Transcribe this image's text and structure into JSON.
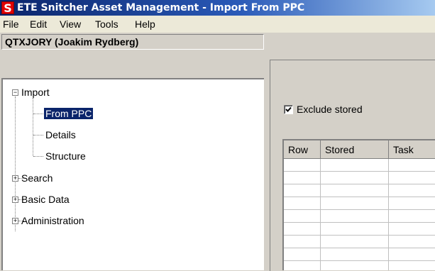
{
  "window": {
    "icon_letter": "S",
    "title": "ETE Snitcher Asset Management - Import From PPC"
  },
  "menu": [
    "File",
    "Edit",
    "View",
    "Tools",
    "Help"
  ],
  "user": {
    "label": "QTXJORY (Joakim Rydberg)"
  },
  "tree": {
    "nodes": [
      {
        "label": "Import",
        "expanded": true,
        "children": [
          "From PPC",
          "Details",
          "Structure"
        ]
      },
      {
        "label": "Search",
        "expanded": false
      },
      {
        "label": "Basic Data",
        "expanded": false
      },
      {
        "label": "Administration",
        "expanded": false
      }
    ],
    "selected": "From PPC"
  },
  "options": {
    "exclude_stored_label": "Exclude stored",
    "exclude_stored_checked": true
  },
  "grid": {
    "columns": [
      "Row",
      "Stored",
      "Task"
    ],
    "rows": []
  }
}
